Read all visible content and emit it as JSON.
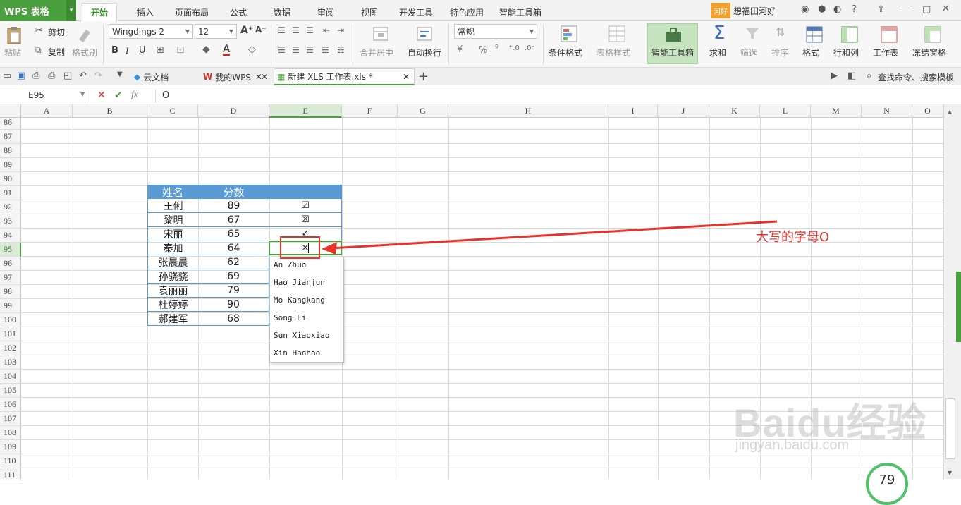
{
  "app": {
    "name": "WPS 表格",
    "caret": "▾"
  },
  "menu": {
    "tabs": [
      "开始",
      "插入",
      "页面布局",
      "公式",
      "数据",
      "审阅",
      "视图",
      "开发工具",
      "特色应用",
      "智能工具箱"
    ],
    "active": "开始",
    "user_badge": "河好",
    "user_name": "想福田河好"
  },
  "ribbon": {
    "paste": "粘贴",
    "cut": "剪切",
    "copy": "复制",
    "format_painter": "格式刷",
    "font_name": "Wingdings 2",
    "font_size": "12",
    "merge_center": "合并居中",
    "wrap_text": "自动换行",
    "number_format": "常规",
    "percent": "%",
    "comma": "⁹",
    "conditional_format": "条件格式",
    "table_style": "表格样式",
    "smart_toolbox": "智能工具箱",
    "sum": "求和",
    "filter": "筛选",
    "sort": "排序",
    "format": "格式",
    "row_col": "行和列",
    "worksheet": "工作表",
    "freeze": "冻结窗格"
  },
  "doctabs": {
    "cloud": "云文档",
    "mywps": "我的WPS",
    "file": "新建 XLS 工作表.xls *",
    "add": "+",
    "search": "查找命令、搜索模板"
  },
  "formula_bar": {
    "cell_ref": "E95",
    "value": "O",
    "fx": "fx"
  },
  "columns": [
    "A",
    "B",
    "C",
    "D",
    "E",
    "F",
    "G",
    "H",
    "I",
    "J",
    "K",
    "L",
    "M",
    "N",
    "O"
  ],
  "selected_column": "E",
  "rows": [
    "86",
    "87",
    "88",
    "89",
    "90",
    "91",
    "92",
    "93",
    "94",
    "95",
    "96",
    "97",
    "98",
    "99",
    "100",
    "101",
    "102",
    "103",
    "104",
    "105",
    "106",
    "107",
    "108",
    "109",
    "110",
    "111"
  ],
  "selected_row": "95",
  "table": {
    "header": {
      "name": "姓名",
      "score": "分数"
    },
    "records": [
      {
        "name": "王俐",
        "score": "89",
        "mark": "☑"
      },
      {
        "name": "黎明",
        "score": "67",
        "mark": "☒"
      },
      {
        "name": "宋丽",
        "score": "65",
        "mark": "✓"
      },
      {
        "name": "秦加",
        "score": "64",
        "mark": "×"
      },
      {
        "name": "张晨晨",
        "score": "62",
        "mark": ""
      },
      {
        "name": "孙骁骁",
        "score": "69",
        "mark": ""
      },
      {
        "name": "袁丽丽",
        "score": "79",
        "mark": ""
      },
      {
        "name": "杜婷婷",
        "score": "90",
        "mark": ""
      },
      {
        "name": "郝建军",
        "score": "68",
        "mark": ""
      }
    ]
  },
  "autocomplete": [
    "An Zhuo",
    "Hao Jianjun",
    "Mo Kangkang",
    "Song Li",
    "Sun Xiaoxiao",
    "Xin Haohao"
  ],
  "annotation": {
    "text": "大写的字母O",
    "color": "#e8322a"
  },
  "watermark": {
    "main": "Baidu经验",
    "sub": "jingyan.baidu.com"
  },
  "perf_badge": "79",
  "colors": {
    "accent": "#4a9f3e",
    "table_header": "#5b9bd5",
    "annotation": "#e8322a"
  }
}
